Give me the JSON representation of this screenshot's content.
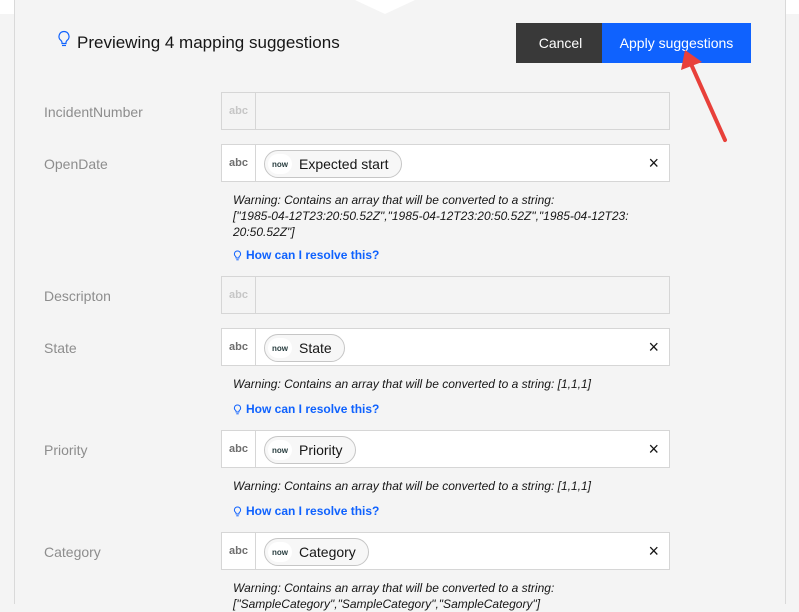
{
  "header": {
    "title": "Previewing 4 mapping suggestions",
    "cancel_label": "Cancel",
    "apply_label": "Apply suggestions"
  },
  "fields": [
    {
      "label": "IncidentNumber",
      "type_tag": "abc"
    },
    {
      "label": "OpenDate",
      "type_tag": "abc",
      "chip": "Expected start",
      "chip_logo": "now",
      "warning_line1": "Warning: Contains an array that will be converted to a string:",
      "warning_line2": "[\"1985-04-12T23:20:50.52Z\",\"1985-04-12T23:20:50.52Z\",\"1985-04-12T23:",
      "warning_line3": "20:50.52Z\"]",
      "help": "How can I resolve this?"
    },
    {
      "label": "Descripton",
      "type_tag": "abc"
    },
    {
      "label": "State",
      "type_tag": "abc",
      "chip": "State",
      "chip_logo": "now",
      "warning": "Warning: Contains an array that will be converted to a string: [1,1,1]",
      "help": "How can I resolve this?"
    },
    {
      "label": "Priority",
      "type_tag": "abc",
      "chip": "Priority",
      "chip_logo": "now",
      "warning": "Warning: Contains an array that will be converted to a string: [1,1,1]",
      "help": "How can I resolve this?"
    },
    {
      "label": "Category",
      "type_tag": "abc",
      "chip": "Category",
      "chip_logo": "now",
      "warning_line1": "Warning: Contains an array that will be converted to a string:",
      "warning_line2": "[\"SampleCategory\",\"SampleCategory\",\"SampleCategory\"]"
    }
  ],
  "close_glyph": "×",
  "colors": {
    "primary": "#0f62fe",
    "secondary": "#393939",
    "annotation_arrow": "#e8403a"
  },
  "icons": [
    "lightbulb-icon",
    "close-icon",
    "servicenow-logo-icon",
    "annotation-arrow"
  ]
}
